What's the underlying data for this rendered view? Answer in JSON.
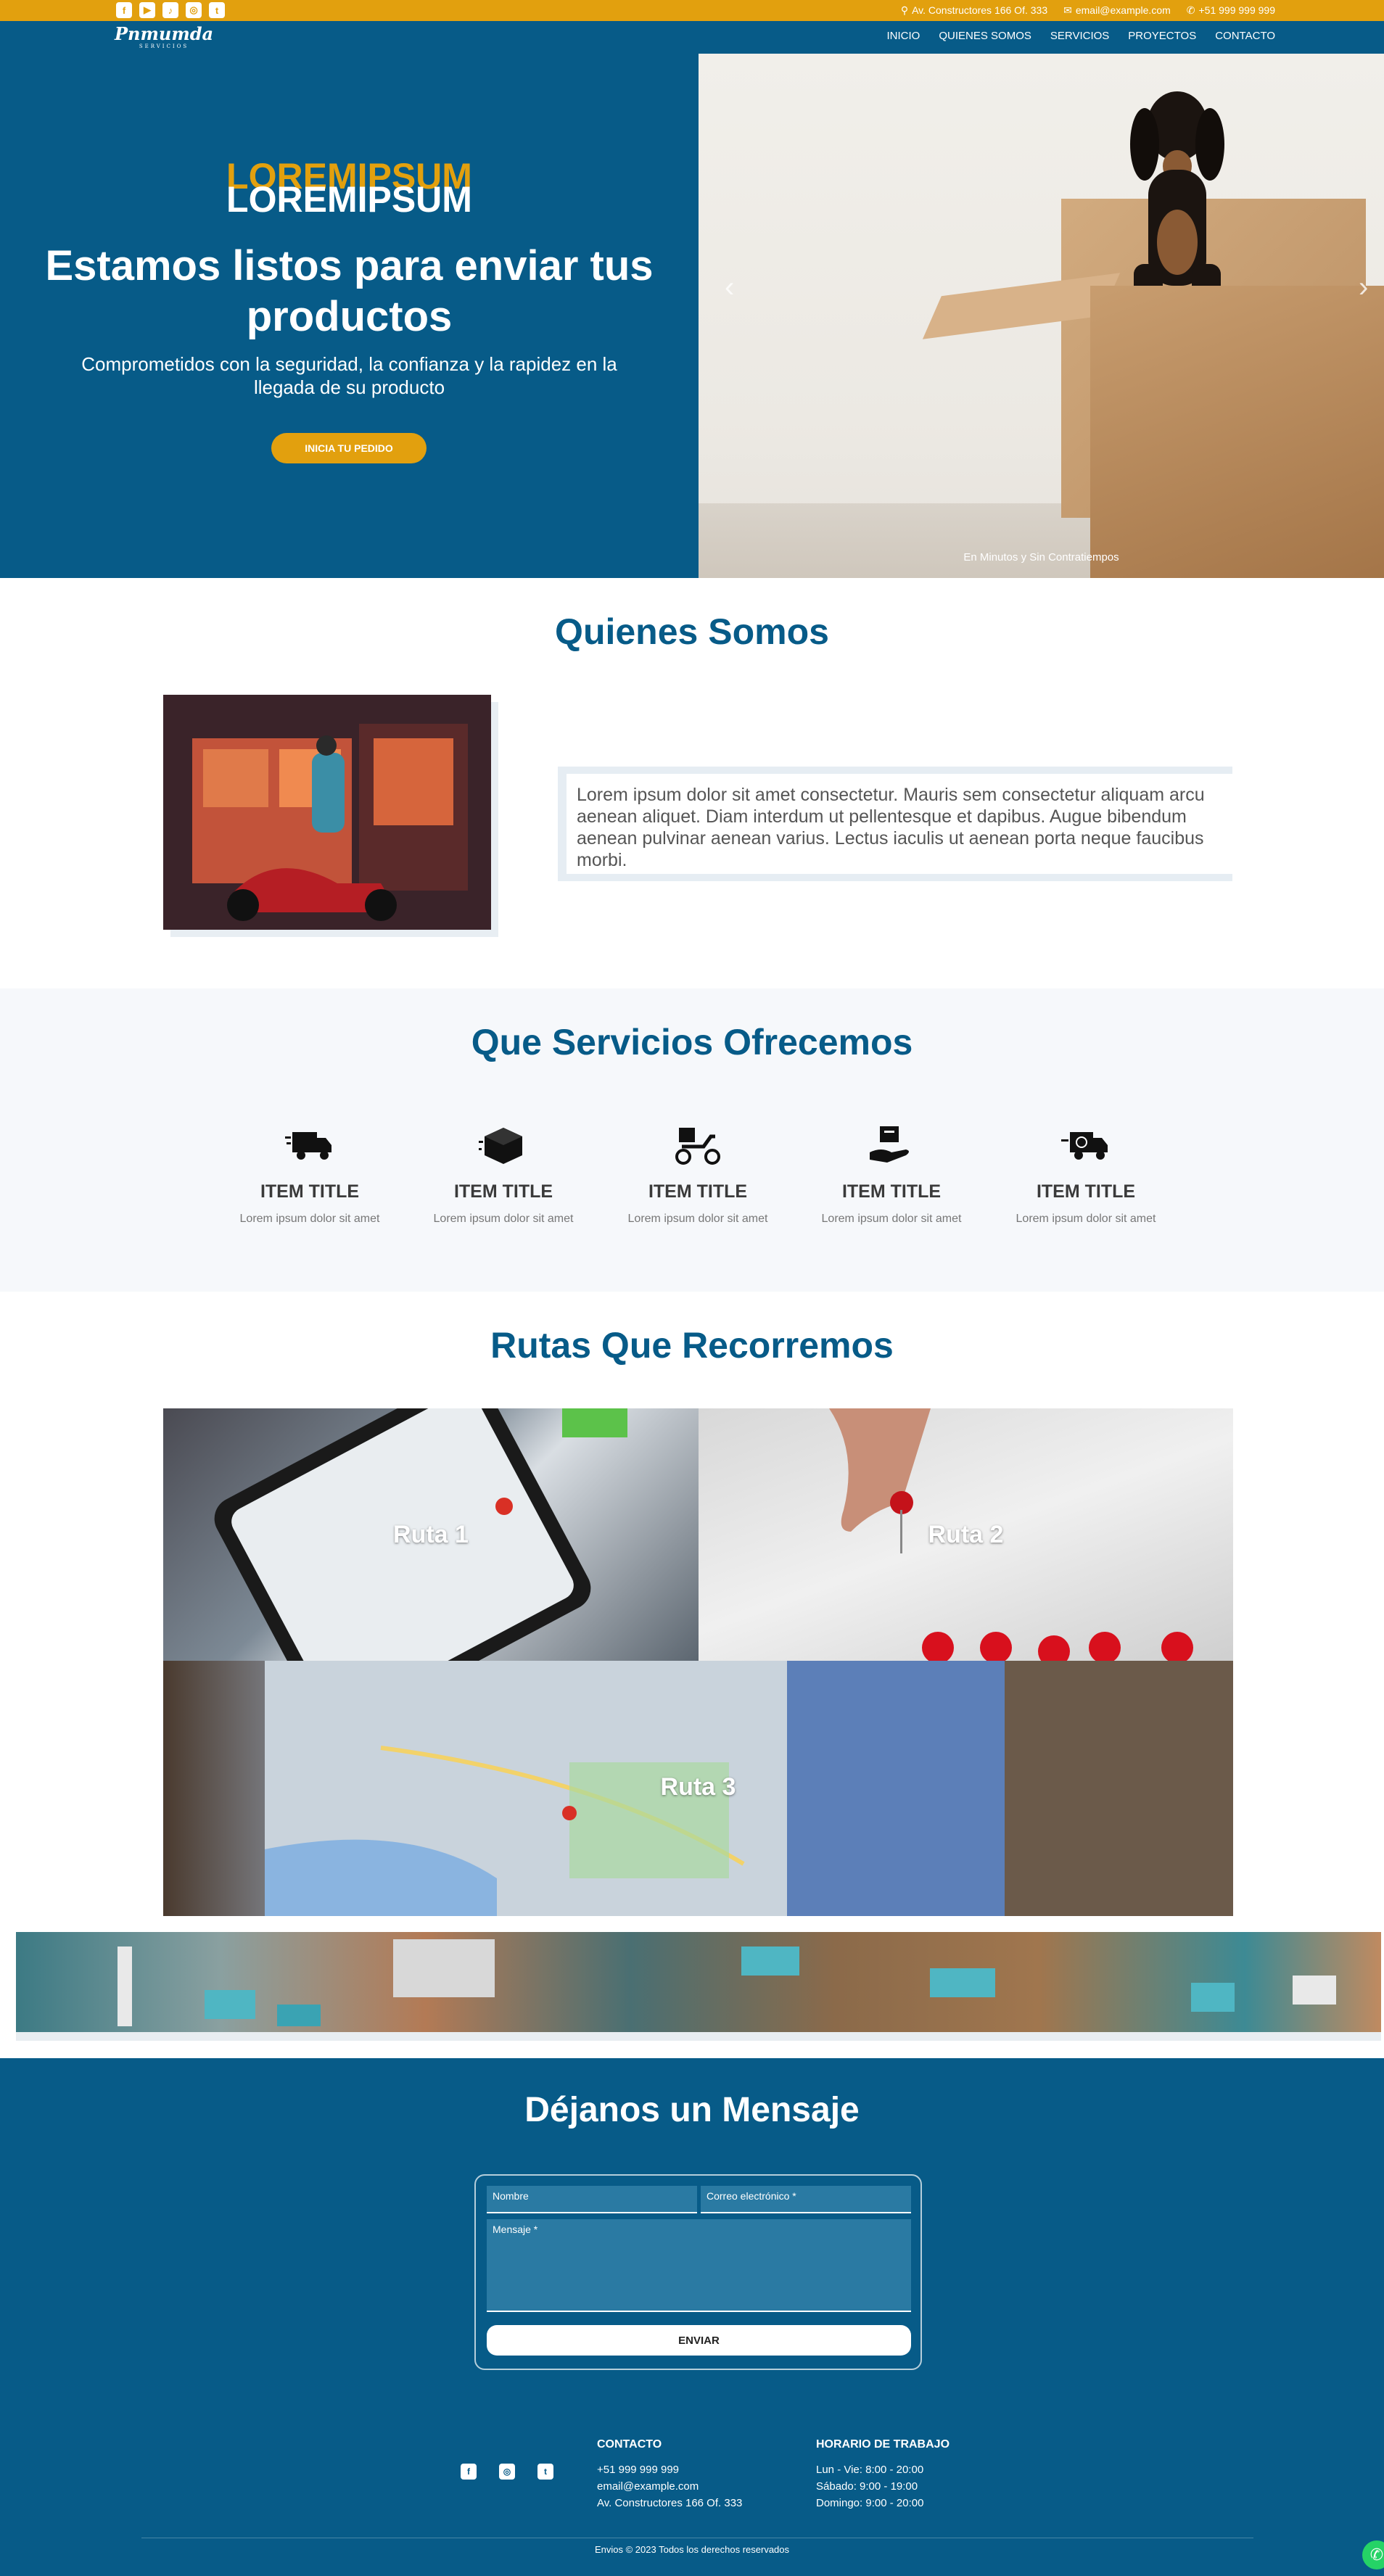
{
  "topbar": {
    "socials": [
      "f",
      "▶",
      "♪",
      "◎",
      "t"
    ],
    "address": "Av. Constructores 166 Of. 333",
    "email": "email@example.com",
    "phone": "+51 999 999 999"
  },
  "nav": {
    "logo": "Pnmumda",
    "logo_sub": "SERVICIOS",
    "items": [
      "INICIO",
      "QUIENES SOMOS",
      "SERVICIOS",
      "PROYECTOS",
      "CONTACTO"
    ]
  },
  "hero": {
    "brand_top": "LOREMIPSUM",
    "brand_bottom": "LOREMIPSUM",
    "title": "Estamos listos para enviar tus productos",
    "subtitle": "Comprometidos con la seguridad, la confianza y la rapidez en la llegada de su producto",
    "button": "INICIA TU PEDIDO",
    "slide_caption": "En Minutos y Sin Contratiempos",
    "prev": "‹",
    "next": "›"
  },
  "about": {
    "title": "Quienes Somos",
    "text": "Lorem ipsum dolor sit amet consectetur. Mauris sem consectetur aliquam arcu aenean aliquet. Diam interdum ut pellentesque et dapibus. Augue bibendum aenean pulvinar aenean varius. Lectus iaculis ut aenean porta neque faucibus morbi."
  },
  "services": {
    "title": "Que Servicios Ofrecemos",
    "items": [
      {
        "icon": "delivery-truck-icon",
        "title": "ITEM TITLE",
        "text": "Lorem ipsum dolor sit amet"
      },
      {
        "icon": "package-box-icon",
        "title": "ITEM TITLE",
        "text": "Lorem ipsum dolor sit amet"
      },
      {
        "icon": "delivery-scooter-icon",
        "title": "ITEM TITLE",
        "text": "Lorem ipsum dolor sit amet"
      },
      {
        "icon": "hand-package-icon",
        "title": "ITEM TITLE",
        "text": "Lorem ipsum dolor sit amet"
      },
      {
        "icon": "fast-truck-icon",
        "title": "ITEM TITLE",
        "text": "Lorem ipsum dolor sit amet"
      }
    ]
  },
  "routes": {
    "title": "Rutas Que Recorremos",
    "items": [
      "Ruta 1",
      "Ruta 2",
      "Ruta 3"
    ]
  },
  "contact": {
    "title": "Déjanos un Mensaje",
    "name_placeholder": "Nombre",
    "email_placeholder": "Correo electrónico *",
    "message_placeholder": "Mensaje *",
    "submit": "ENVIAR"
  },
  "footer": {
    "socials": [
      "f",
      "◎",
      "t"
    ],
    "contact_title": "CONTACTO",
    "contact_lines": [
      "+51 999 999 999",
      "email@example.com",
      "Av. Constructores 166 Of. 333"
    ],
    "hours_title": "HORARIO DE TRABAJO",
    "hours_lines": [
      "Lun - Vie: 8:00 - 20:00",
      "Sábado: 9:00 - 19:00",
      "Domingo: 9:00 - 20:00"
    ],
    "copyright": "Envios © 2023 Todos los derechos reservados"
  },
  "colors": {
    "primary": "#075b88",
    "accent": "#e2a00e",
    "whatsapp": "#25d366"
  }
}
